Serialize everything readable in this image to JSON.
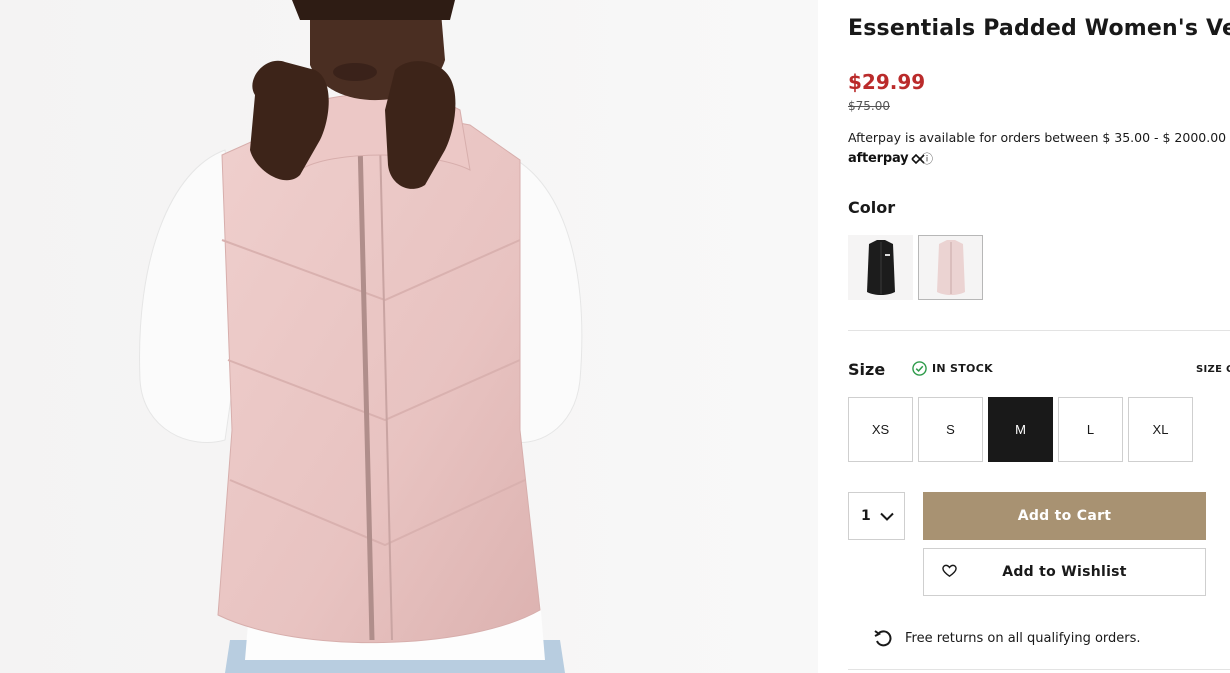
{
  "product": {
    "title": "Essentials Padded Women's Vest",
    "price": "$29.99",
    "original_price": "$75.00",
    "image_alt": "model-wearing-pink-padded-vest"
  },
  "afterpay": {
    "text": "Afterpay is available for orders between $ 35.00 - $ 2000.00",
    "logo_text": "afterpay",
    "info_glyph": "ⓘ"
  },
  "color": {
    "label": "Color",
    "swatches": [
      {
        "name": "black",
        "hex": "#1c1c1c",
        "selected": false
      },
      {
        "name": "pink",
        "hex": "#ebd3d2",
        "selected": true
      }
    ]
  },
  "size": {
    "label": "Size",
    "stock_status": "IN STOCK",
    "guide_label": "SIZE GUIDE",
    "options": [
      {
        "label": "XS",
        "selected": false
      },
      {
        "label": "S",
        "selected": false
      },
      {
        "label": "M",
        "selected": true
      },
      {
        "label": "L",
        "selected": false
      },
      {
        "label": "XL",
        "selected": false
      }
    ]
  },
  "purchase": {
    "quantity": "1",
    "add_to_cart_label": "Add to Cart",
    "add_to_wishlist_label": "Add to Wishlist"
  },
  "returns": {
    "text": "Free returns on all qualifying orders."
  },
  "icons": {
    "stock": "check-circle-icon",
    "quantity": "chevron-down-icon",
    "wishlist": "heart-icon",
    "returns": "return-arrow-icon",
    "afterpay": "afterpay-loop-icon"
  },
  "colors": {
    "sale_price": "#ba2b2b",
    "add_to_cart_bg": "#a89272",
    "selected_size_bg": "#191919",
    "stock_check": "#2e9b4a"
  }
}
